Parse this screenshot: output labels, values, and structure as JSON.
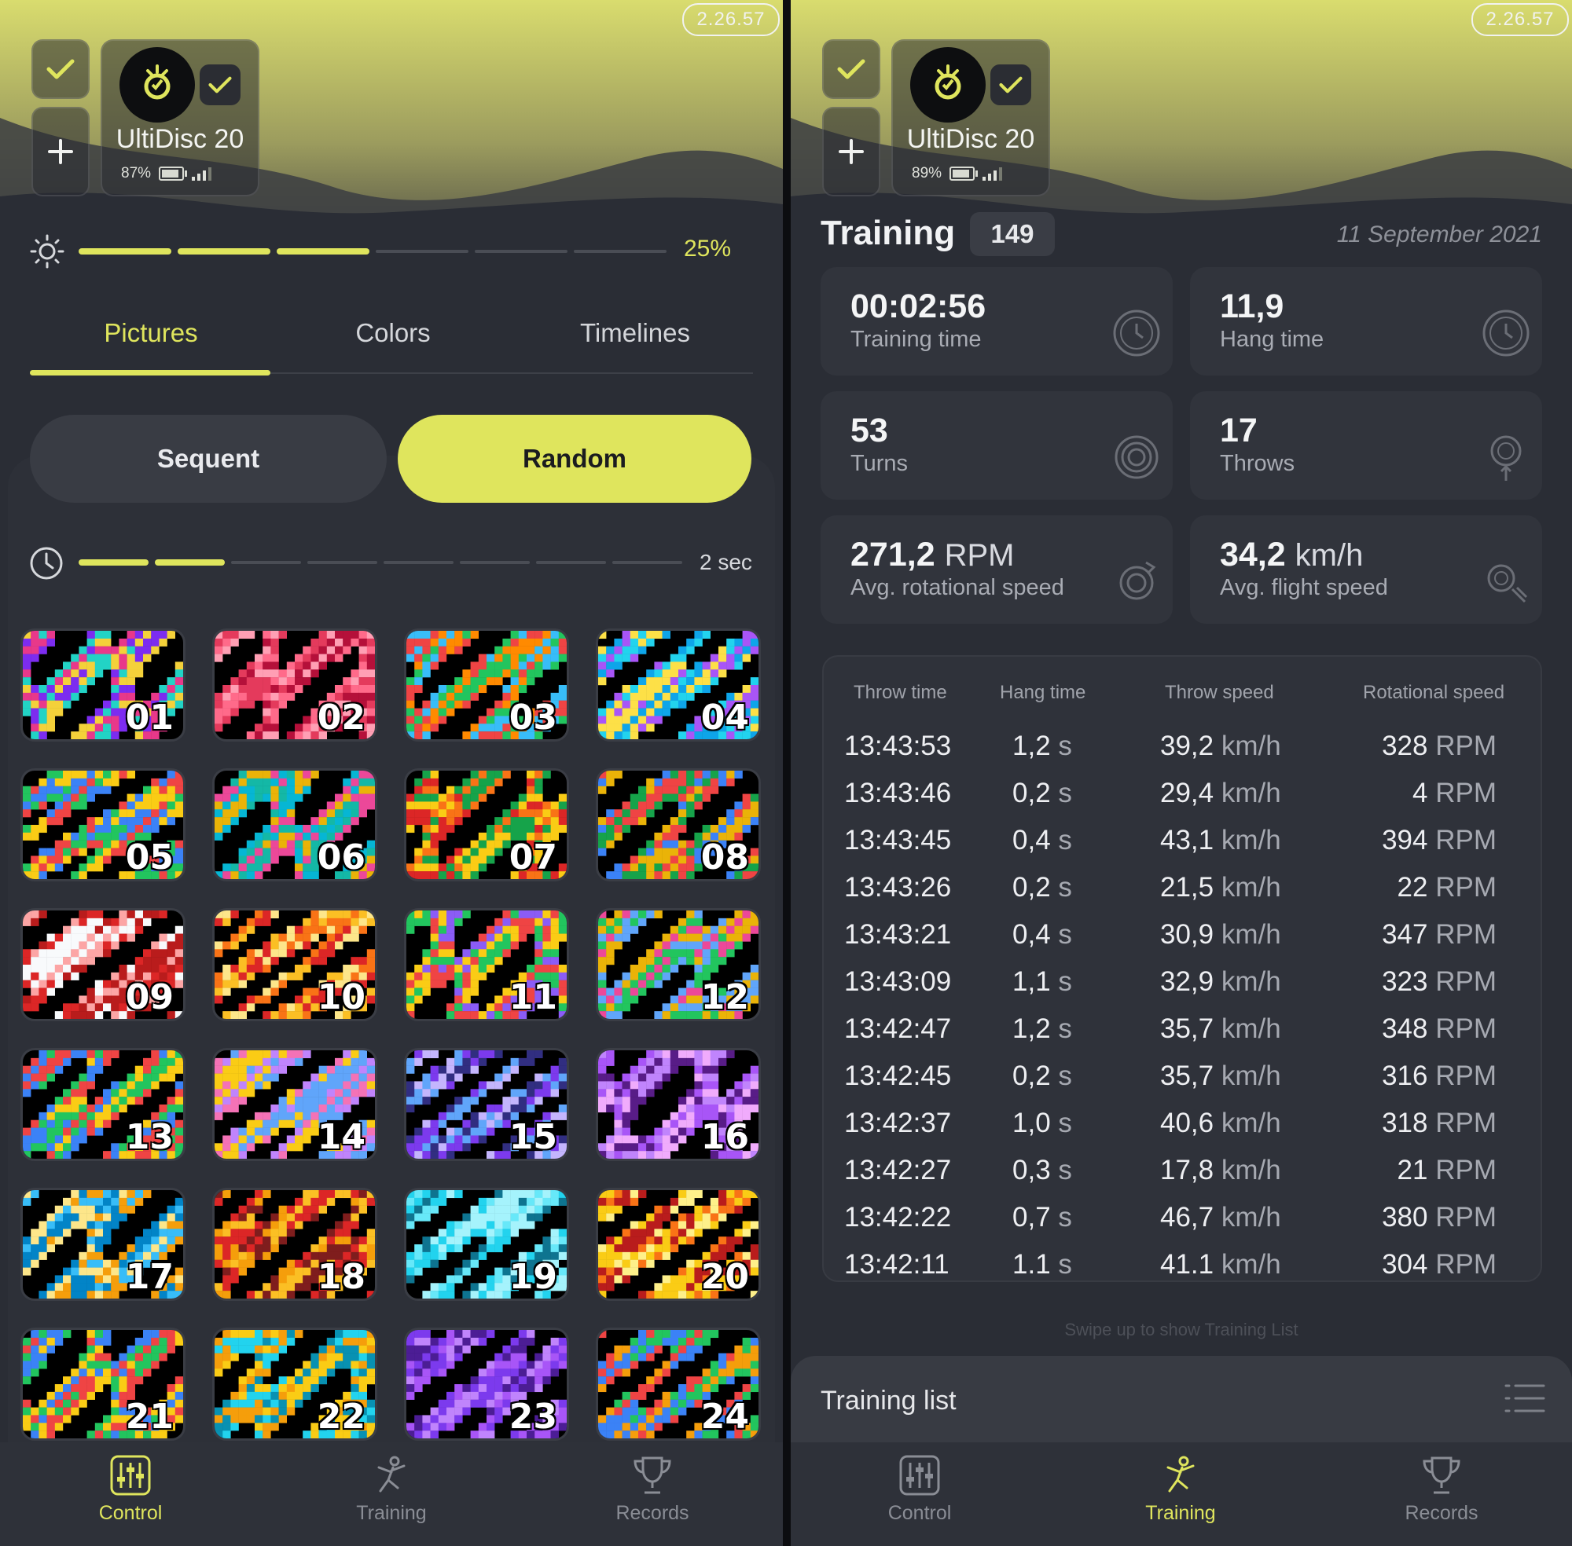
{
  "left": {
    "version": "2.26.57",
    "device": {
      "name": "UltiDisc 20",
      "battery": "87%",
      "battery_level": 0.87
    },
    "brightness": {
      "value_label": "25%",
      "segments_on": 3,
      "segments_total": 6
    },
    "tabs": [
      "Pictures",
      "Colors",
      "Timelines"
    ],
    "active_tab": "Pictures",
    "mode": {
      "sequent_label": "Sequent",
      "random_label": "Random",
      "selected": "Random"
    },
    "interval": {
      "value_label": "2 sec",
      "segments_on": 2,
      "segments_total": 8
    },
    "pictures": [
      "01",
      "02",
      "03",
      "04",
      "05",
      "06",
      "07",
      "08",
      "09",
      "10",
      "11",
      "12",
      "13",
      "14",
      "15",
      "16",
      "17",
      "18",
      "19",
      "20",
      "21",
      "22",
      "23",
      "24"
    ],
    "nav": {
      "control": "Control",
      "training": "Training",
      "records": "Records",
      "active": "Control"
    }
  },
  "right": {
    "version": "2.26.57",
    "device": {
      "name": "UltiDisc 20",
      "battery": "89%",
      "battery_level": 0.89
    },
    "training_title": "Training",
    "training_count": "149",
    "date": "11 September 2021",
    "stats": {
      "training_time": {
        "value": "00:02:56",
        "label": "Training time"
      },
      "hang_time": {
        "value": "11,9",
        "label": "Hang time"
      },
      "turns": {
        "value": "53",
        "label": "Turns"
      },
      "throws": {
        "value": "17",
        "label": "Throws"
      },
      "rot_speed": {
        "value": "271,2",
        "unit": "RPM",
        "label": "Avg. rotational speed"
      },
      "flight_speed": {
        "value": "34,2",
        "unit": "km/h",
        "label": "Avg. flight speed"
      }
    },
    "table": {
      "headers": [
        "Throw time",
        "Hang time",
        "Throw speed",
        "Rotational speed"
      ],
      "rows": [
        {
          "time": "13:43:53",
          "hang": "1,2",
          "hang_unit": "s",
          "speed": "39,2",
          "speed_unit": "km/h",
          "rot": "328",
          "rot_unit": "RPM"
        },
        {
          "time": "13:43:46",
          "hang": "0,2",
          "hang_unit": "s",
          "speed": "29,4",
          "speed_unit": "km/h",
          "rot": "4",
          "rot_unit": "RPM"
        },
        {
          "time": "13:43:45",
          "hang": "0,4",
          "hang_unit": "s",
          "speed": "43,1",
          "speed_unit": "km/h",
          "rot": "394",
          "rot_unit": "RPM"
        },
        {
          "time": "13:43:26",
          "hang": "0,2",
          "hang_unit": "s",
          "speed": "21,5",
          "speed_unit": "km/h",
          "rot": "22",
          "rot_unit": "RPM"
        },
        {
          "time": "13:43:21",
          "hang": "0,4",
          "hang_unit": "s",
          "speed": "30,9",
          "speed_unit": "km/h",
          "rot": "347",
          "rot_unit": "RPM"
        },
        {
          "time": "13:43:09",
          "hang": "1,1",
          "hang_unit": "s",
          "speed": "32,9",
          "speed_unit": "km/h",
          "rot": "323",
          "rot_unit": "RPM"
        },
        {
          "time": "13:42:47",
          "hang": "1,2",
          "hang_unit": "s",
          "speed": "35,7",
          "speed_unit": "km/h",
          "rot": "348",
          "rot_unit": "RPM"
        },
        {
          "time": "13:42:45",
          "hang": "0,2",
          "hang_unit": "s",
          "speed": "35,7",
          "speed_unit": "km/h",
          "rot": "316",
          "rot_unit": "RPM"
        },
        {
          "time": "13:42:37",
          "hang": "1,0",
          "hang_unit": "s",
          "speed": "40,6",
          "speed_unit": "km/h",
          "rot": "318",
          "rot_unit": "RPM"
        },
        {
          "time": "13:42:27",
          "hang": "0,3",
          "hang_unit": "s",
          "speed": "17,8",
          "speed_unit": "km/h",
          "rot": "21",
          "rot_unit": "RPM"
        },
        {
          "time": "13:42:22",
          "hang": "0,7",
          "hang_unit": "s",
          "speed": "46,7",
          "speed_unit": "km/h",
          "rot": "380",
          "rot_unit": "RPM"
        },
        {
          "time": "13:42:11",
          "hang": "1.1",
          "hang_unit": "s",
          "speed": "41.1",
          "speed_unit": "km/h",
          "rot": "304",
          "rot_unit": "RPM"
        }
      ]
    },
    "swipe_hint": "Swipe up to show Training List",
    "training_list_label": "Training list",
    "nav": {
      "control": "Control",
      "training": "Training",
      "records": "Records",
      "active": "Training"
    }
  },
  "colors": {
    "accent": "#dfe55d",
    "background": "#2a2d35",
    "card": "#31343c"
  }
}
